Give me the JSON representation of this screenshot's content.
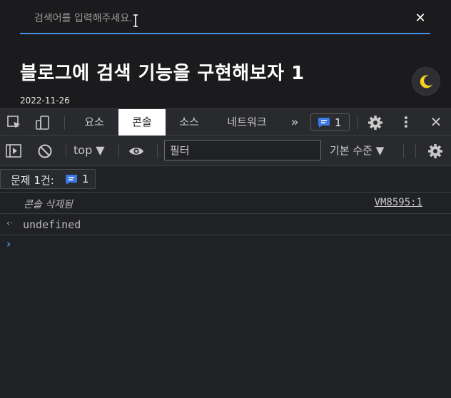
{
  "page": {
    "search": {
      "placeholder": "검색어를 입력해주세요.",
      "close_label": "✕"
    },
    "post": {
      "title": "블로그에 검색 기능을 구현해보자 1",
      "date": "2022-11-26"
    },
    "theme_toggle_icon": "moon-icon"
  },
  "devtools": {
    "tabs": [
      {
        "label": "요소"
      },
      {
        "label": "콘솔"
      },
      {
        "label": "소스"
      },
      {
        "label": "네트워크"
      }
    ],
    "more_tabs_label": "»",
    "issues_count": "1",
    "kebab_label": "⋮",
    "close_label": "✕",
    "toolbar": {
      "context": "top ▼",
      "filter_placeholder": "필터",
      "levels": "기본 수준 ▼"
    },
    "issuebar": {
      "label": "문제 1건:",
      "count": "1"
    },
    "console": {
      "cleared_message": "콘솔 삭제됨",
      "cleared_source": "VM8595:1",
      "return_icon": "‹·",
      "return_value": "undefined",
      "prompt_caret": "›"
    }
  },
  "colors": {
    "accent": "#4a90e2",
    "issue_blue": "#3b78e7",
    "moon": "#f5d21f"
  }
}
